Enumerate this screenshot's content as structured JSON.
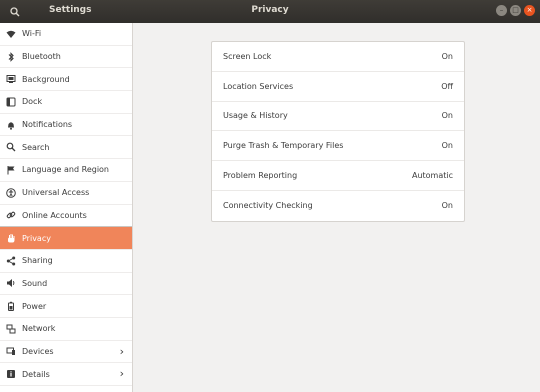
{
  "titlebar": {
    "app_title": "Settings",
    "page_title": "Privacy"
  },
  "sidebar": {
    "items": [
      {
        "label": "Wi-Fi",
        "icon": "wifi-icon"
      },
      {
        "label": "Bluetooth",
        "icon": "bluetooth-icon"
      },
      {
        "label": "Background",
        "icon": "background-icon"
      },
      {
        "label": "Dock",
        "icon": "dock-icon"
      },
      {
        "label": "Notifications",
        "icon": "bell-icon"
      },
      {
        "label": "Search",
        "icon": "search-icon"
      },
      {
        "label": "Language and Region",
        "icon": "flag-icon"
      },
      {
        "label": "Universal Access",
        "icon": "accessibility-icon"
      },
      {
        "label": "Online Accounts",
        "icon": "link-icon"
      },
      {
        "label": "Privacy",
        "icon": "hand-icon",
        "active": true
      },
      {
        "label": "Sharing",
        "icon": "share-icon"
      },
      {
        "label": "Sound",
        "icon": "speaker-icon"
      },
      {
        "label": "Power",
        "icon": "battery-icon"
      },
      {
        "label": "Network",
        "icon": "network-icon"
      },
      {
        "label": "Devices",
        "icon": "devices-icon",
        "has_submenu": true
      },
      {
        "label": "Details",
        "icon": "info-icon",
        "has_submenu": true
      }
    ]
  },
  "privacy": {
    "rows": [
      {
        "label": "Screen Lock",
        "value": "On"
      },
      {
        "label": "Location Services",
        "value": "Off"
      },
      {
        "label": "Usage & History",
        "value": "On"
      },
      {
        "label": "Purge Trash & Temporary Files",
        "value": "On"
      },
      {
        "label": "Problem Reporting",
        "value": "Automatic"
      },
      {
        "label": "Connectivity Checking",
        "value": "On"
      }
    ]
  },
  "colors": {
    "accent": "#f0855a",
    "titlebar": "#3a3733",
    "close_button": "#e95420"
  }
}
